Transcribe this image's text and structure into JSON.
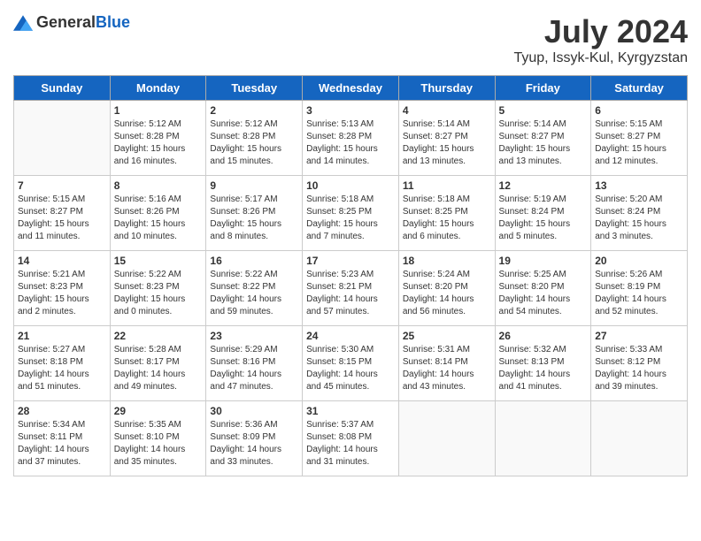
{
  "header": {
    "logo_general": "General",
    "logo_blue": "Blue",
    "title": "July 2024",
    "subtitle": "Tyup, Issyk-Kul, Kyrgyzstan"
  },
  "calendar": {
    "days_of_week": [
      "Sunday",
      "Monday",
      "Tuesday",
      "Wednesday",
      "Thursday",
      "Friday",
      "Saturday"
    ],
    "weeks": [
      [
        {
          "num": "",
          "info": ""
        },
        {
          "num": "1",
          "info": "Sunrise: 5:12 AM\nSunset: 8:28 PM\nDaylight: 15 hours\nand 16 minutes."
        },
        {
          "num": "2",
          "info": "Sunrise: 5:12 AM\nSunset: 8:28 PM\nDaylight: 15 hours\nand 15 minutes."
        },
        {
          "num": "3",
          "info": "Sunrise: 5:13 AM\nSunset: 8:28 PM\nDaylight: 15 hours\nand 14 minutes."
        },
        {
          "num": "4",
          "info": "Sunrise: 5:14 AM\nSunset: 8:27 PM\nDaylight: 15 hours\nand 13 minutes."
        },
        {
          "num": "5",
          "info": "Sunrise: 5:14 AM\nSunset: 8:27 PM\nDaylight: 15 hours\nand 13 minutes."
        },
        {
          "num": "6",
          "info": "Sunrise: 5:15 AM\nSunset: 8:27 PM\nDaylight: 15 hours\nand 12 minutes."
        }
      ],
      [
        {
          "num": "7",
          "info": "Sunrise: 5:15 AM\nSunset: 8:27 PM\nDaylight: 15 hours\nand 11 minutes."
        },
        {
          "num": "8",
          "info": "Sunrise: 5:16 AM\nSunset: 8:26 PM\nDaylight: 15 hours\nand 10 minutes."
        },
        {
          "num": "9",
          "info": "Sunrise: 5:17 AM\nSunset: 8:26 PM\nDaylight: 15 hours\nand 8 minutes."
        },
        {
          "num": "10",
          "info": "Sunrise: 5:18 AM\nSunset: 8:25 PM\nDaylight: 15 hours\nand 7 minutes."
        },
        {
          "num": "11",
          "info": "Sunrise: 5:18 AM\nSunset: 8:25 PM\nDaylight: 15 hours\nand 6 minutes."
        },
        {
          "num": "12",
          "info": "Sunrise: 5:19 AM\nSunset: 8:24 PM\nDaylight: 15 hours\nand 5 minutes."
        },
        {
          "num": "13",
          "info": "Sunrise: 5:20 AM\nSunset: 8:24 PM\nDaylight: 15 hours\nand 3 minutes."
        }
      ],
      [
        {
          "num": "14",
          "info": "Sunrise: 5:21 AM\nSunset: 8:23 PM\nDaylight: 15 hours\nand 2 minutes."
        },
        {
          "num": "15",
          "info": "Sunrise: 5:22 AM\nSunset: 8:23 PM\nDaylight: 15 hours\nand 0 minutes."
        },
        {
          "num": "16",
          "info": "Sunrise: 5:22 AM\nSunset: 8:22 PM\nDaylight: 14 hours\nand 59 minutes."
        },
        {
          "num": "17",
          "info": "Sunrise: 5:23 AM\nSunset: 8:21 PM\nDaylight: 14 hours\nand 57 minutes."
        },
        {
          "num": "18",
          "info": "Sunrise: 5:24 AM\nSunset: 8:20 PM\nDaylight: 14 hours\nand 56 minutes."
        },
        {
          "num": "19",
          "info": "Sunrise: 5:25 AM\nSunset: 8:20 PM\nDaylight: 14 hours\nand 54 minutes."
        },
        {
          "num": "20",
          "info": "Sunrise: 5:26 AM\nSunset: 8:19 PM\nDaylight: 14 hours\nand 52 minutes."
        }
      ],
      [
        {
          "num": "21",
          "info": "Sunrise: 5:27 AM\nSunset: 8:18 PM\nDaylight: 14 hours\nand 51 minutes."
        },
        {
          "num": "22",
          "info": "Sunrise: 5:28 AM\nSunset: 8:17 PM\nDaylight: 14 hours\nand 49 minutes."
        },
        {
          "num": "23",
          "info": "Sunrise: 5:29 AM\nSunset: 8:16 PM\nDaylight: 14 hours\nand 47 minutes."
        },
        {
          "num": "24",
          "info": "Sunrise: 5:30 AM\nSunset: 8:15 PM\nDaylight: 14 hours\nand 45 minutes."
        },
        {
          "num": "25",
          "info": "Sunrise: 5:31 AM\nSunset: 8:14 PM\nDaylight: 14 hours\nand 43 minutes."
        },
        {
          "num": "26",
          "info": "Sunrise: 5:32 AM\nSunset: 8:13 PM\nDaylight: 14 hours\nand 41 minutes."
        },
        {
          "num": "27",
          "info": "Sunrise: 5:33 AM\nSunset: 8:12 PM\nDaylight: 14 hours\nand 39 minutes."
        }
      ],
      [
        {
          "num": "28",
          "info": "Sunrise: 5:34 AM\nSunset: 8:11 PM\nDaylight: 14 hours\nand 37 minutes."
        },
        {
          "num": "29",
          "info": "Sunrise: 5:35 AM\nSunset: 8:10 PM\nDaylight: 14 hours\nand 35 minutes."
        },
        {
          "num": "30",
          "info": "Sunrise: 5:36 AM\nSunset: 8:09 PM\nDaylight: 14 hours\nand 33 minutes."
        },
        {
          "num": "31",
          "info": "Sunrise: 5:37 AM\nSunset: 8:08 PM\nDaylight: 14 hours\nand 31 minutes."
        },
        {
          "num": "",
          "info": ""
        },
        {
          "num": "",
          "info": ""
        },
        {
          "num": "",
          "info": ""
        }
      ]
    ]
  }
}
